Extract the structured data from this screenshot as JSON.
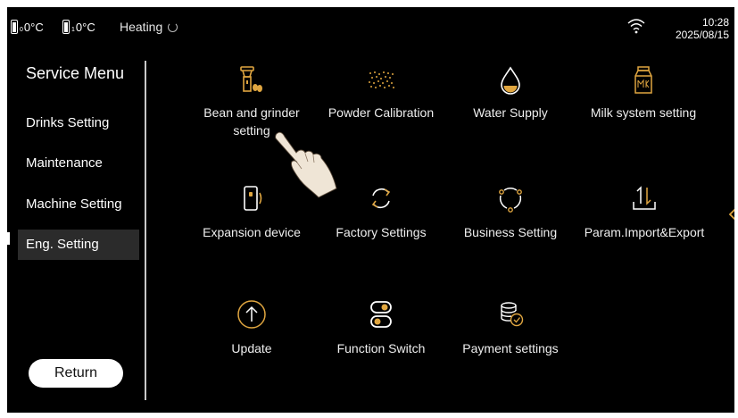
{
  "status": {
    "tank1_value": "0°C",
    "tank2_value": "0°C",
    "heating_label": "Heating",
    "time": "10:28",
    "date": "2025/08/15"
  },
  "sidebar": {
    "title": "Service Menu",
    "items": [
      {
        "label": "Drinks Setting",
        "active": false
      },
      {
        "label": "Maintenance",
        "active": false
      },
      {
        "label": "Machine Setting",
        "active": false
      },
      {
        "label": "Eng. Setting",
        "active": true
      }
    ],
    "return_label": "Return"
  },
  "grid": {
    "items": [
      {
        "label": "Bean and grinder setting",
        "icon": "bean-grinder-icon"
      },
      {
        "label": "Powder Calibration",
        "icon": "powder-icon"
      },
      {
        "label": "Water Supply",
        "icon": "water-drop-icon"
      },
      {
        "label": "Milk system setting",
        "icon": "milk-carton-icon"
      },
      {
        "label": "Expansion device",
        "icon": "expansion-device-icon"
      },
      {
        "label": "Factory Settings",
        "icon": "factory-reset-icon"
      },
      {
        "label": "Business Setting",
        "icon": "business-cycle-icon"
      },
      {
        "label": "Param.Import&Export",
        "icon": "import-export-icon"
      },
      {
        "label": "Update",
        "icon": "update-arrow-icon"
      },
      {
        "label": "Function Switch",
        "icon": "toggle-switch-icon"
      },
      {
        "label": "Payment settings",
        "icon": "payment-coins-icon"
      }
    ]
  },
  "colors": {
    "background": "#000000",
    "accent_gold": "#e0a640",
    "text": "#ffffff",
    "active_item_bg": "#2b2b2b"
  }
}
